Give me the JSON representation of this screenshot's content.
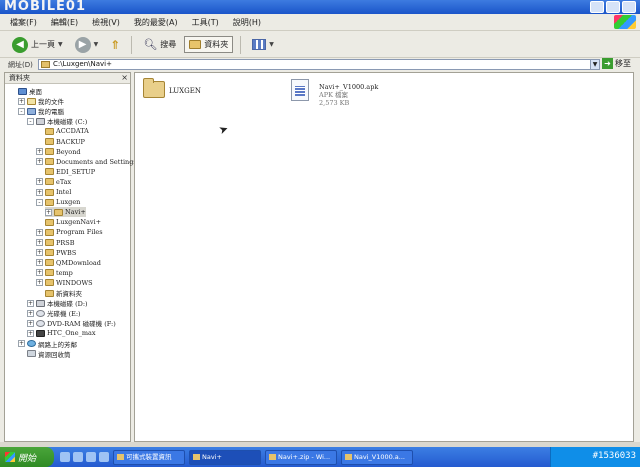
{
  "watermark": "MOBILE01",
  "menu": {
    "items": [
      "檔案(F)",
      "編輯(E)",
      "檢視(V)",
      "我的最愛(A)",
      "工具(T)",
      "說明(H)"
    ]
  },
  "toolbar": {
    "back_label": "上一頁",
    "search_label": "搜尋",
    "folders_label": "資料夾"
  },
  "address": {
    "label": "網址(D)",
    "value": "C:\\Luxgen\\Navi+",
    "go_label": "移至"
  },
  "folders_pane": {
    "title": "資料夾",
    "items": [
      {
        "label": "桌面",
        "icon": "desktop-icon"
      },
      {
        "label": "我的文件",
        "icon": "documents-icon"
      },
      {
        "label": "我的電腦",
        "icon": "computer-icon"
      },
      {
        "label": "本機磁碟 (C:)",
        "icon": "drive-icon"
      },
      {
        "label": "ACCDATA",
        "icon": "folder-icon"
      },
      {
        "label": "BACKUP",
        "icon": "folder-icon"
      },
      {
        "label": "Beyond",
        "icon": "folder-icon"
      },
      {
        "label": "Documents and Settings",
        "icon": "folder-icon"
      },
      {
        "label": "EDI_SETUP",
        "icon": "folder-icon"
      },
      {
        "label": "eTax",
        "icon": "folder-icon"
      },
      {
        "label": "Intel",
        "icon": "folder-icon"
      },
      {
        "label": "Luxgen",
        "icon": "folder-icon"
      },
      {
        "label": "Navi+",
        "icon": "folder-icon"
      },
      {
        "label": "LuxgenNavi+",
        "icon": "folder-icon"
      },
      {
        "label": "Program Files",
        "icon": "folder-icon"
      },
      {
        "label": "PRSB",
        "icon": "folder-icon"
      },
      {
        "label": "PWBS",
        "icon": "folder-icon"
      },
      {
        "label": "QMDownload",
        "icon": "folder-icon"
      },
      {
        "label": "temp",
        "icon": "folder-icon"
      },
      {
        "label": "WINDOWS",
        "icon": "folder-icon"
      },
      {
        "label": "新資料夾",
        "icon": "folder-icon"
      },
      {
        "label": "本機磁碟 (D:)",
        "icon": "drive-icon"
      },
      {
        "label": "光碟機 (E:)",
        "icon": "cd-drive-icon"
      },
      {
        "label": "DVD-RAM 磁碟機 (F:)",
        "icon": "cd-drive-icon"
      },
      {
        "label": "HTC_One_max",
        "icon": "phone-icon"
      },
      {
        "label": "網路上的芳鄰",
        "icon": "network-icon"
      },
      {
        "label": "資源回收筒",
        "icon": "recycle-bin-icon"
      }
    ]
  },
  "content": {
    "folder": {
      "name": "LUXGEN"
    },
    "file": {
      "name": "Navi+_V1000.apk",
      "type": "APK 檔案",
      "size": "2,573 KB"
    }
  },
  "taskbar": {
    "start_label": "開始",
    "tasks": [
      {
        "label": "可攜式裝置資訊"
      },
      {
        "label": "Navi+"
      },
      {
        "label": "Navi+.zip - Wi..."
      },
      {
        "label": "Navi_V1000.a..."
      }
    ],
    "tray_label": "#1536033"
  }
}
